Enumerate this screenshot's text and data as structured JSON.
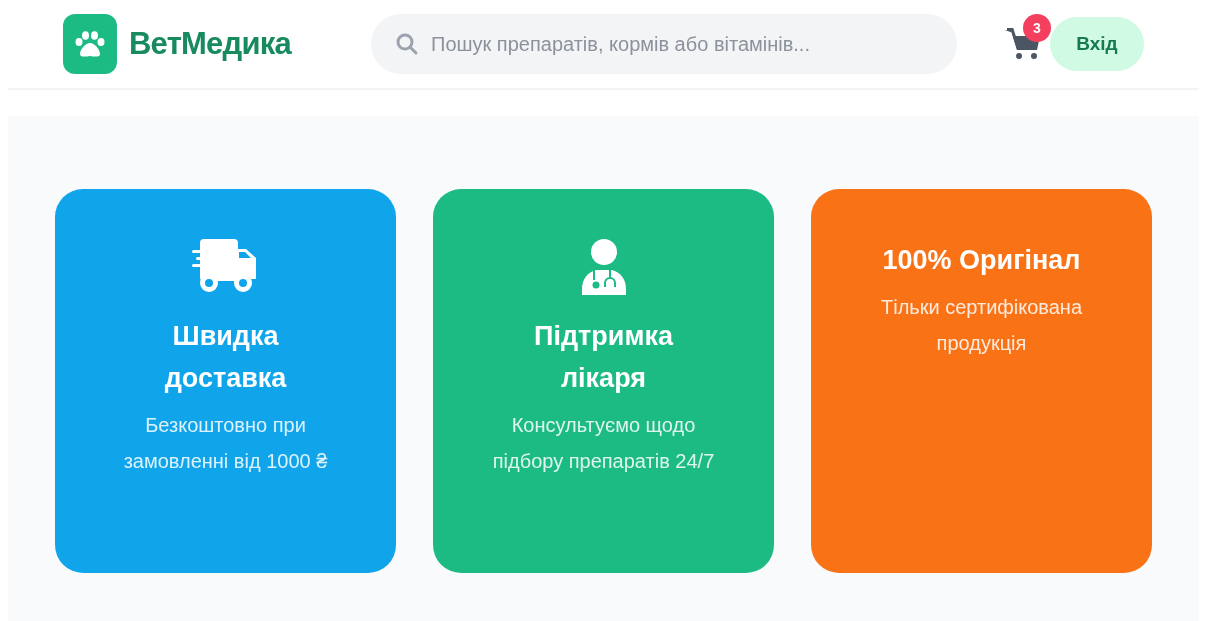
{
  "header": {
    "logo": "ВетМедика",
    "search": {
      "placeholder": "Пошук препаратів, кормів або вітамінів..."
    },
    "cart": {
      "count": "3"
    },
    "login": "Вхід"
  },
  "features": [
    {
      "kind": "truck",
      "color": "#10a5ea",
      "title": "Швидка доставка",
      "text": "Безкоштовно при замовленні від 1000 ₴"
    },
    {
      "kind": "doctor",
      "color": "#1dbb84",
      "title": "Підтримка лікаря",
      "text": "Консультуємо щодо підбору препаратів 24/7"
    },
    {
      "color": "#f97316",
      "title": "100% Оригінал",
      "text": "Тільки сертифікована продукція"
    }
  ]
}
